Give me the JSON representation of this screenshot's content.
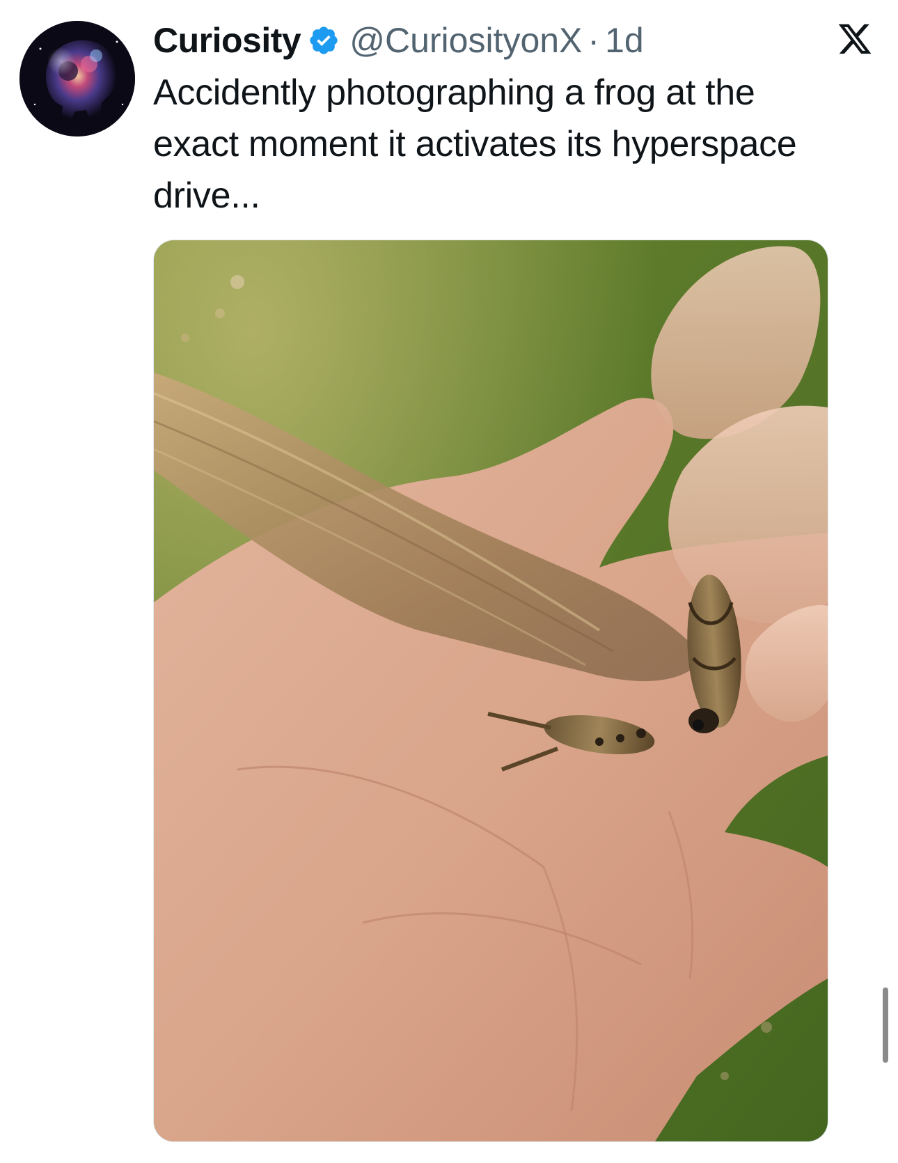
{
  "tweet": {
    "author_name": "Curiosity",
    "handle": "@CuriosityonX",
    "separator": "·",
    "time": "1d",
    "text": "Accidently photographing a frog at the exact moment it activates its hyperspace drive...",
    "avatar_icon": "space-skull-avatar",
    "verified_icon": "verified-badge-icon",
    "platform_icon": "x-logo-icon",
    "media_description_icon": "frog-photo"
  },
  "colors": {
    "verified": "#1d9bf0",
    "text_primary": "#0f1419",
    "text_secondary": "#536471"
  }
}
